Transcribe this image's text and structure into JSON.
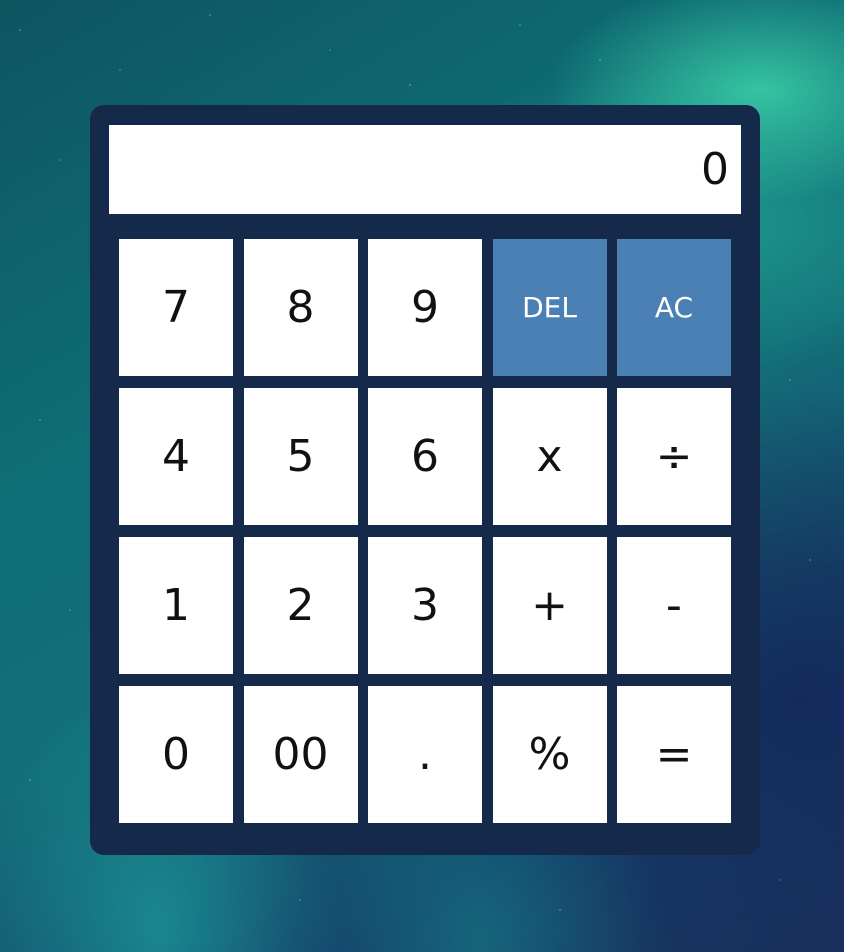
{
  "display": {
    "value": "0"
  },
  "keys": [
    {
      "label": "7",
      "name": "key-7",
      "accent": false
    },
    {
      "label": "8",
      "name": "key-8",
      "accent": false
    },
    {
      "label": "9",
      "name": "key-9",
      "accent": false
    },
    {
      "label": "DEL",
      "name": "delete-button",
      "accent": true
    },
    {
      "label": "AC",
      "name": "all-clear-button",
      "accent": true
    },
    {
      "label": "4",
      "name": "key-4",
      "accent": false
    },
    {
      "label": "5",
      "name": "key-5",
      "accent": false
    },
    {
      "label": "6",
      "name": "key-6",
      "accent": false
    },
    {
      "label": "x",
      "name": "multiply-button",
      "accent": false
    },
    {
      "label": "÷",
      "name": "divide-button",
      "accent": false
    },
    {
      "label": "1",
      "name": "key-1",
      "accent": false
    },
    {
      "label": "2",
      "name": "key-2",
      "accent": false
    },
    {
      "label": "3",
      "name": "key-3",
      "accent": false
    },
    {
      "label": "+",
      "name": "add-button",
      "accent": false
    },
    {
      "label": "-",
      "name": "subtract-button",
      "accent": false
    },
    {
      "label": "0",
      "name": "key-0",
      "accent": false
    },
    {
      "label": "00",
      "name": "key-00",
      "accent": false
    },
    {
      "label": ".",
      "name": "decimal-button",
      "accent": false
    },
    {
      "label": "%",
      "name": "percent-button",
      "accent": false
    },
    {
      "label": "=",
      "name": "equals-button",
      "accent": false
    }
  ],
  "colors": {
    "body": "#15294a",
    "accent_key": "#4a80b4",
    "key": "#ffffff"
  }
}
